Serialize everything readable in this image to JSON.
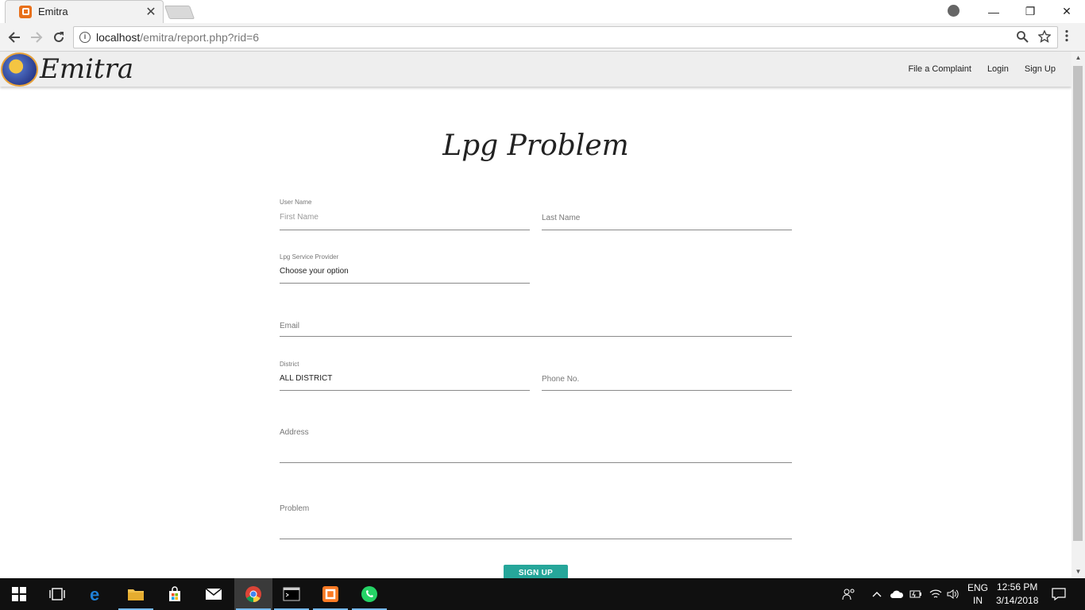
{
  "browser": {
    "tab_title": "Emitra",
    "tab_close": "✕",
    "url_host": "localhost",
    "url_path": "/emitra/report.php?rid=6",
    "minimize": "—",
    "maximize": "❐",
    "close": "✕"
  },
  "site": {
    "brand": "Emitra",
    "nav": [
      {
        "label": "File a Complaint"
      },
      {
        "label": "Login"
      },
      {
        "label": "Sign Up"
      }
    ]
  },
  "form": {
    "heading": "Lpg Problem",
    "username_label": "User Name",
    "first_name_placeholder": "First Name",
    "last_name_placeholder": "Last Name",
    "provider_label": "Lpg Service Provider",
    "provider_value": "Choose your option",
    "email_placeholder": "Email",
    "district_label": "District",
    "district_value": "ALL DISTRICT",
    "phone_placeholder": "Phone No.",
    "address_placeholder": "Address",
    "problem_placeholder": "Problem",
    "submit_label": "SIGN UP"
  },
  "taskbar": {
    "lang": "ENG",
    "region": "IN",
    "time": "12:56 PM",
    "date": "3/14/2018"
  },
  "colors": {
    "accent": "#26a69a",
    "navbar_bg": "#eeeeee",
    "taskbar_bg": "#101010"
  }
}
